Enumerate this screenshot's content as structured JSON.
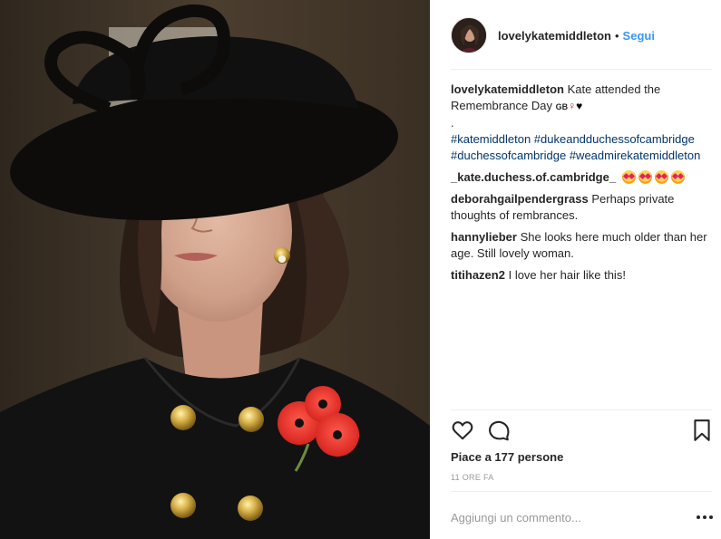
{
  "post": {
    "username": "lovelykatemiddleton",
    "separator": "•",
    "follow_label": "Segui",
    "photo_alt": "photo",
    "avatar_name": "avatar"
  },
  "caption": {
    "username": "lovelykatemiddleton",
    "text": "Kate attended the Remembrance Day",
    "flag_text": "GB",
    "dot_line": ".",
    "hashtags": [
      "#katemiddleton",
      "#dukeandduchessofcambridge",
      "#duchessofcambridge",
      "#weadmirekatemiddleton"
    ]
  },
  "comments": [
    {
      "username": "_kate.duchess.of.cambridge_",
      "text": "",
      "emoji": "heart-eyes-face-icon",
      "emoji_count": 4
    },
    {
      "username": "deborahgailpendergrass",
      "text": "Perhaps private thoughts of rembrances."
    },
    {
      "username": "hannylieber",
      "text": "She looks here much older than her age. Still lovely woman."
    },
    {
      "username": "titihazen2",
      "text": "I love her hair like this!"
    }
  ],
  "actions": {
    "like_icon": "heart-outline-icon",
    "comment_icon": "comment-bubble-icon",
    "save_icon": "bookmark-icon"
  },
  "likes_text": "Piace a 177 persone",
  "timestamp": "11 ORE FA",
  "add_comment_placeholder": "Aggiungi un commento...",
  "more_icon": "more-options-icon",
  "colors": {
    "link_blue": "#3897f0",
    "hashtag": "#003569",
    "muted": "#999999",
    "text": "#262626",
    "divider": "#efefef"
  }
}
